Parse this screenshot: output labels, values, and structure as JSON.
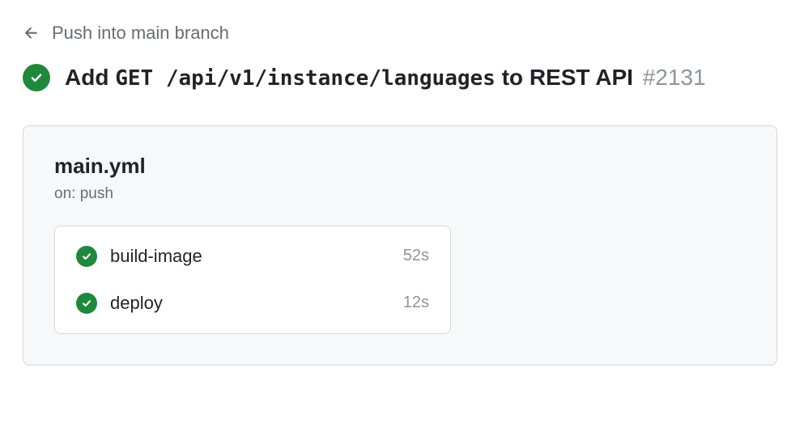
{
  "back": {
    "label": "Push into main branch"
  },
  "run": {
    "title_prefix": "Add ",
    "title_code": "GET /api/v1/instance/languages",
    "title_suffix": " to REST API",
    "issue_number": "#2131"
  },
  "workflow": {
    "file": "main.yml",
    "trigger": "on: push",
    "jobs": [
      {
        "status": "success",
        "name": "build-image",
        "duration": "52s"
      },
      {
        "status": "success",
        "name": "deploy",
        "duration": "12s"
      }
    ]
  }
}
